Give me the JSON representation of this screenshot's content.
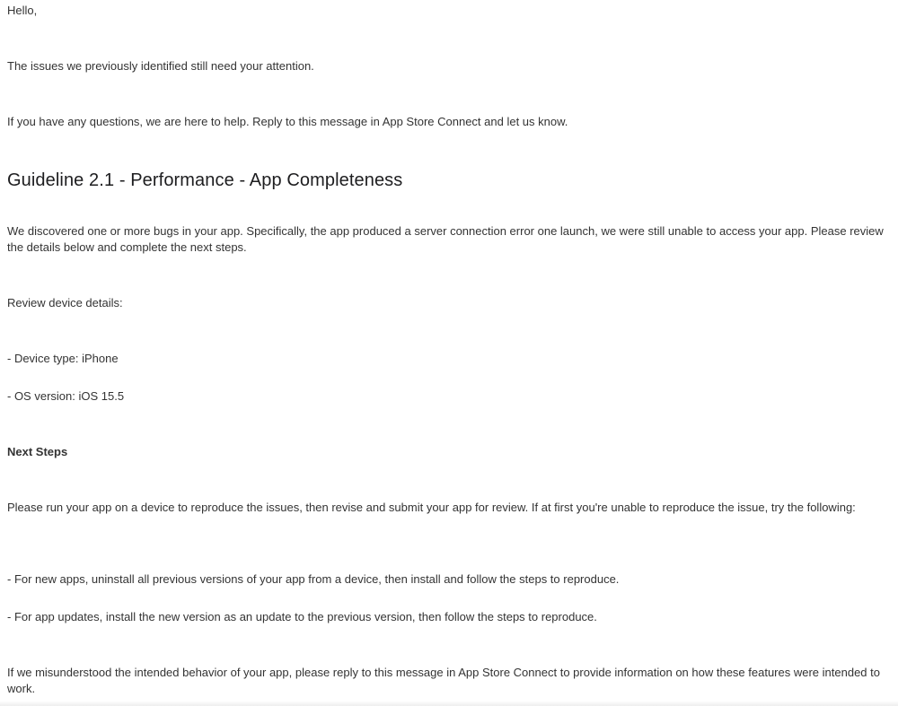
{
  "message": {
    "greeting": "Hello,",
    "intro": "The issues we previously identified still need your attention.",
    "help": "If you have any questions, we are here to help. Reply to this message in App Store Connect and let us know.",
    "guideline_title": "Guideline 2.1 - Performance - App Completeness",
    "bug_description": "We discovered one or more bugs in your app. Specifically, the app produced a server connection error one launch, we were still unable to access your app. Please review the details below and complete the next steps.",
    "review_device_label": "Review device details:",
    "device_type": "- Device type: iPhone",
    "os_version": "- OS version: iOS 15.5",
    "next_steps_heading": "Next Steps",
    "next_steps_intro": "Please run your app on a device to reproduce the issues, then revise and submit your app for review. If at first you're unable to reproduce the issue, try the following:",
    "step_new_apps": "- For new apps, uninstall all previous versions of your app from a device, then install and follow the steps to reproduce.",
    "step_app_updates": "- For app updates, install the new version as an update to the previous version, then follow the steps to reproduce.",
    "misunderstood": "If we misunderstood the intended behavior of your app, please reply to this message in App Store Connect to provide information on how these features were intended to work."
  }
}
